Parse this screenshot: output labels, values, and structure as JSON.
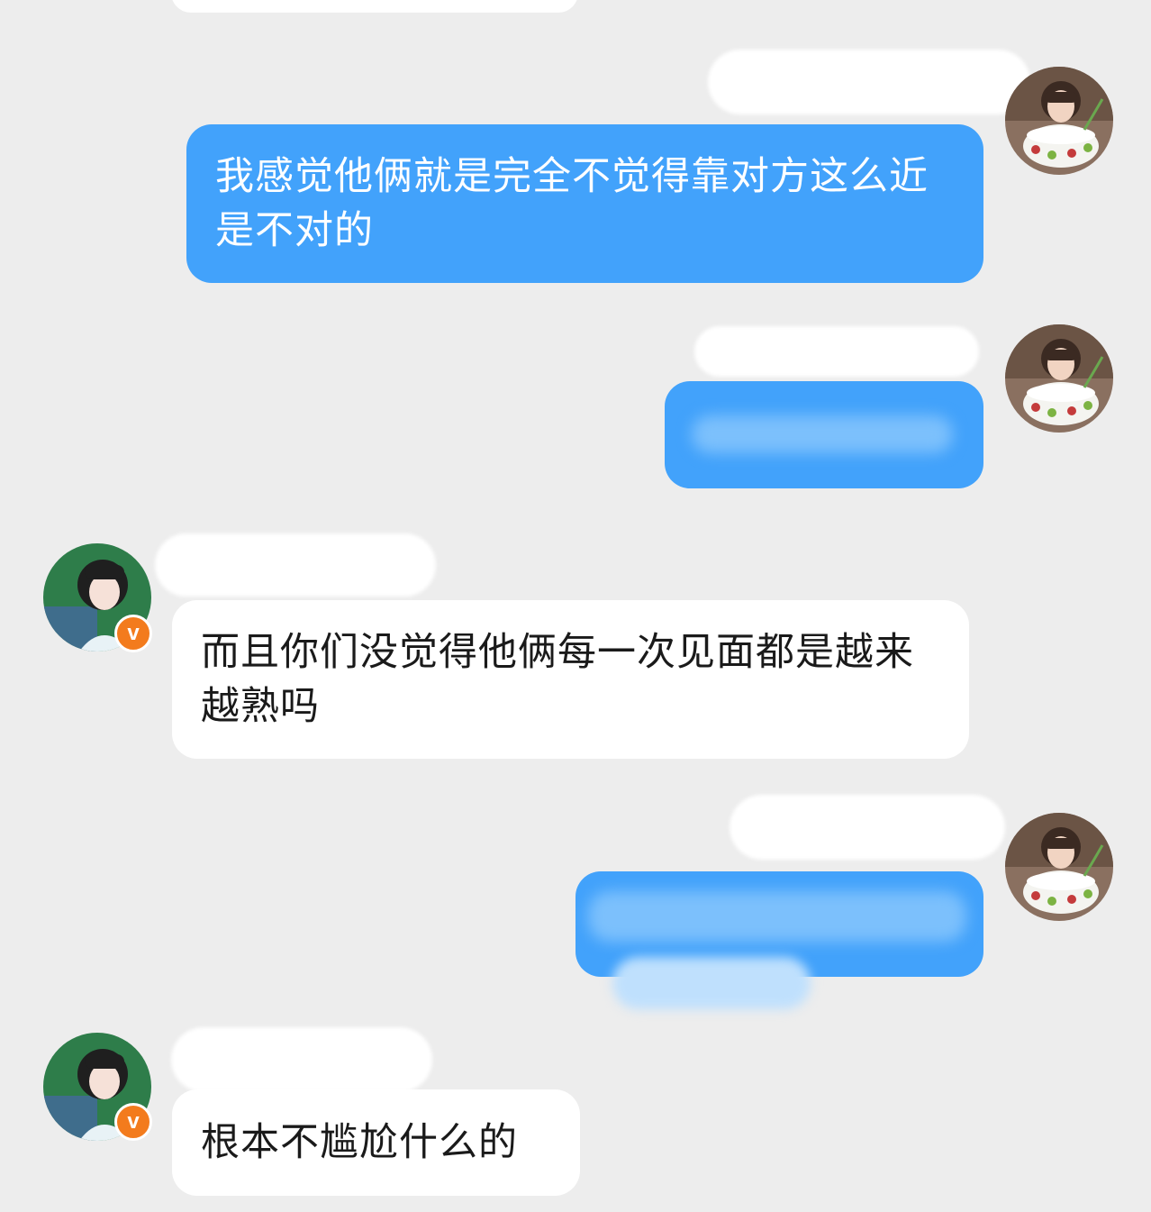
{
  "messages": {
    "msg1": "我感觉他俩就是完全不觉得靠对方这么近是不对的",
    "msg3": "而且你们没觉得他俩每一次见面都是越来越熟吗",
    "msg5": "根本不尴尬什么的"
  },
  "badges": {
    "verified_letter": "v"
  },
  "colors": {
    "background": "#ededed",
    "outgoing_bubble": "#42a2fb",
    "incoming_bubble": "#ffffff",
    "verified_badge": "#f37b1d"
  },
  "icons": {
    "self_avatar": "avatar-cake-girl",
    "other_avatar": "avatar-green-girl",
    "verified": "verified-badge-icon"
  }
}
